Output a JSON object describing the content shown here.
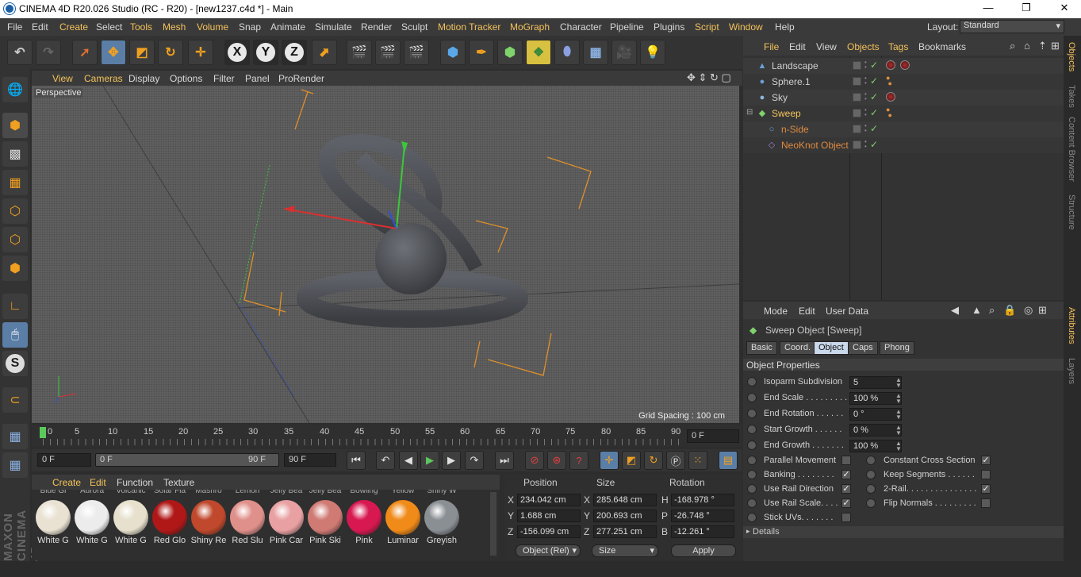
{
  "window": {
    "title": "CINEMA 4D R20.026 Studio (RC - R20) - [new1237.c4d *] - Main",
    "controls": [
      "—",
      "❐",
      "✕"
    ]
  },
  "menubar": {
    "items": [
      "File",
      "Edit",
      "Create",
      "Select",
      "Tools",
      "Mesh",
      "Volume",
      "Snap",
      "Animate",
      "Simulate",
      "Render",
      "Sculpt",
      "Motion Tracker",
      "MoGraph",
      "Character",
      "Pipeline",
      "Plugins",
      "Script",
      "Window",
      "Help"
    ],
    "layout_label": "Layout:",
    "layout_value": "Standard"
  },
  "toolbar": {
    "axes": [
      "X",
      "Y",
      "Z"
    ]
  },
  "viewport": {
    "menu": [
      "View",
      "Cameras",
      "Display",
      "Options",
      "Filter",
      "Panel",
      "ProRender"
    ],
    "camera_label": "Perspective",
    "grid_spacing": "Grid Spacing : 100 cm"
  },
  "timeline": {
    "ticks": [
      "0",
      "5",
      "10",
      "15",
      "20",
      "25",
      "30",
      "35",
      "40",
      "45",
      "50",
      "55",
      "60",
      "65",
      "70",
      "75",
      "80",
      "85",
      "90"
    ],
    "current_frame": "0 F"
  },
  "controls": {
    "start": "0 F",
    "range_start": "0 F",
    "range_end": "90 F",
    "end": "90 F"
  },
  "materials": {
    "menu": [
      "Create",
      "Edit",
      "Function",
      "Texture"
    ],
    "top_labels": [
      "Blue Gl",
      "Aurora",
      "Volcanic",
      "Solar Fla",
      "Mashro",
      "Lemon",
      "Jelly Bea",
      "Jelly Bea",
      "Bowling",
      "Yellow",
      "Shiny W"
    ],
    "items": [
      {
        "label": "White G",
        "color": "#e9e2d3"
      },
      {
        "label": "White G",
        "color": "#ececec"
      },
      {
        "label": "White G",
        "color": "#e6e0cc"
      },
      {
        "label": "Red Glo",
        "color": "#b01818"
      },
      {
        "label": "Shiny Re",
        "color": "#c0482c"
      },
      {
        "label": "Red Slu",
        "color": "#e0908a"
      },
      {
        "label": "Pink Car",
        "color": "#e8a0a2"
      },
      {
        "label": "Pink Ski",
        "color": "#d07a74"
      },
      {
        "label": "Pink",
        "color": "#d81850"
      },
      {
        "label": "Luminar",
        "color": "#f08a18"
      },
      {
        "label": "Greyish",
        "color": "#8a8f94"
      }
    ]
  },
  "coordinates": {
    "headers": [
      "Position",
      "Size",
      "Rotation"
    ],
    "rows": [
      {
        "axis": "X",
        "pos": "234.042 cm",
        "size_axis": "X",
        "size": "285.648 cm",
        "rot_axis": "H",
        "rot": "-168.978 °"
      },
      {
        "axis": "Y",
        "pos": "1.688 cm",
        "size_axis": "Y",
        "size": "200.693 cm",
        "rot_axis": "P",
        "rot": "-26.748 °"
      },
      {
        "axis": "Z",
        "pos": "-156.099 cm",
        "size_axis": "Z",
        "size": "277.251 cm",
        "rot_axis": "B",
        "rot": "-12.261 °"
      }
    ],
    "mode": "Object (Rel)",
    "size_mode": "Size",
    "apply": "Apply"
  },
  "objects_panel": {
    "menu": [
      "File",
      "Edit",
      "View",
      "Objects",
      "Tags",
      "Bookmarks"
    ],
    "items": [
      {
        "name": "Landscape",
        "indent": 0,
        "icon": "▲",
        "icon_color": "#6aa0d8",
        "name_color": "#d0d0d0",
        "tag": "material"
      },
      {
        "name": "Sphere.1",
        "indent": 0,
        "icon": "●",
        "icon_color": "#6aa0d8",
        "name_color": "#d0d0d0",
        "tag": "phong"
      },
      {
        "name": "Sky",
        "indent": 0,
        "icon": "●",
        "icon_color": "#8fb8e0",
        "name_color": "#d0d0d0",
        "tag": "material"
      },
      {
        "name": "Sweep",
        "indent": 0,
        "icon": "◆",
        "icon_color": "#7fd36b",
        "name_color": "#f4c25a",
        "tag": "phong"
      },
      {
        "name": "n-Side",
        "indent": 1,
        "icon": "○",
        "icon_color": "#6aa0d8",
        "name_color": "#e08a40",
        "tag": ""
      },
      {
        "name": "NeoKnot Object",
        "indent": 1,
        "icon": "◇",
        "icon_color": "#9a7fd0",
        "name_color": "#e08a40",
        "tag": ""
      }
    ]
  },
  "attributes": {
    "menu": [
      "Mode",
      "Edit",
      "User Data"
    ],
    "object_title": "Sweep Object [Sweep]",
    "tabs": [
      "Basic",
      "Coord.",
      "Object",
      "Caps",
      "Phong"
    ],
    "active_tab": "Object",
    "section": "Object Properties",
    "fields": [
      {
        "label": "Isoparm Subdivision",
        "value": "5"
      },
      {
        "label": "End Scale . . . . . . . . .",
        "value": "100 %"
      },
      {
        "label": "End Rotation . . . . . .",
        "value": "0 °"
      },
      {
        "label": "Start Growth . . . . . .",
        "value": "0 %"
      },
      {
        "label": "End Growth . . . . . . .",
        "value": "100 %"
      }
    ],
    "checks_left": [
      {
        "label": "Parallel Movement",
        "checked": false
      },
      {
        "label": "Banking . . . . . . . .",
        "checked": true
      },
      {
        "label": "Use Rail Direction",
        "checked": true
      },
      {
        "label": "Use Rail Scale. . . .",
        "checked": true
      },
      {
        "label": "Stick UVs. . . . . . .",
        "checked": false
      }
    ],
    "checks_right": [
      {
        "label": "Constant Cross Section",
        "checked": true
      },
      {
        "label": "Keep Segments . . . . . .",
        "checked": false
      },
      {
        "label": "2-Rail. . . . . . . . . . . . . . .",
        "checked": true
      },
      {
        "label": "Flip Normals . . . . . . . . .",
        "checked": false
      }
    ],
    "details": "Details"
  },
  "side_tabs": {
    "top": [
      "Objects",
      "Takes",
      "Content Browser",
      "Structure"
    ],
    "bottom": [
      "Attributes",
      "Layers"
    ]
  },
  "brand": "MAXON CINEMA 4D"
}
